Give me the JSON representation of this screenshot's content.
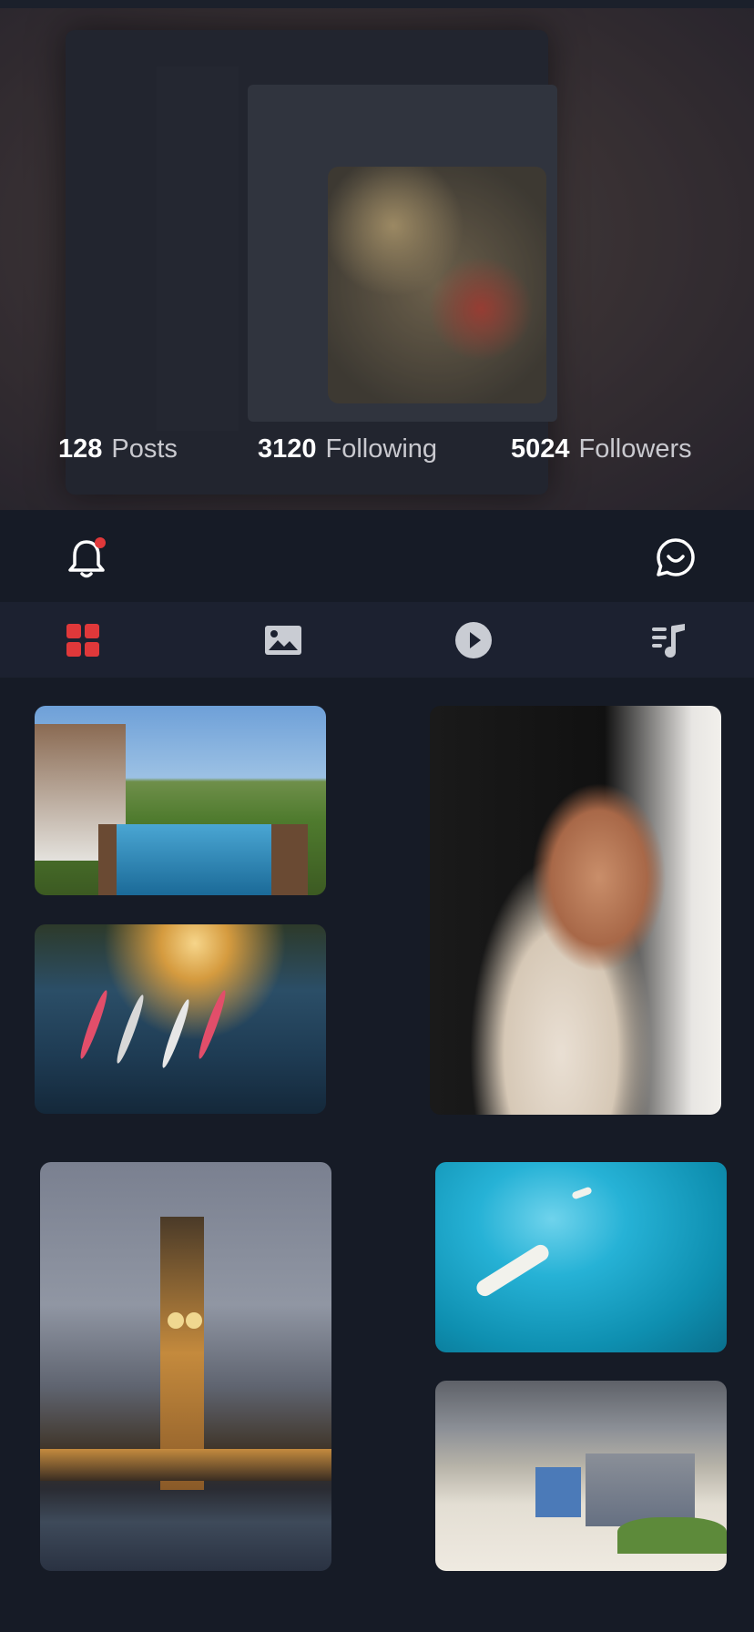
{
  "profile": {
    "stats": [
      {
        "value": "128",
        "label": "Posts"
      },
      {
        "value": "3120",
        "label": "Following"
      },
      {
        "value": "5024",
        "label": "Followers"
      }
    ]
  },
  "icons": {
    "notifications": "bell-icon",
    "messages": "chat-icon",
    "notification_badge_color": "#e0383a"
  },
  "tabs": [
    {
      "name": "grid",
      "icon": "grid-icon",
      "active": true,
      "color": "#e0383a"
    },
    {
      "name": "photos",
      "icon": "image-icon",
      "active": false,
      "color": "#c9ccd3"
    },
    {
      "name": "videos",
      "icon": "play-icon",
      "active": false,
      "color": "#c9ccd3"
    },
    {
      "name": "music",
      "icon": "music-playlist-icon",
      "active": false,
      "color": "#c9ccd3"
    }
  ],
  "colors": {
    "background": "#161b26",
    "tabbar": "#1c2130",
    "accent": "#e0383a"
  },
  "gallery": [
    {
      "subject": "house-with-pool"
    },
    {
      "subject": "kayakers-on-river"
    },
    {
      "subject": "woman-portrait"
    },
    {
      "subject": "big-ben-at-dusk"
    },
    {
      "subject": "yacht-turquoise-sea"
    },
    {
      "subject": "beach-huts"
    }
  ]
}
